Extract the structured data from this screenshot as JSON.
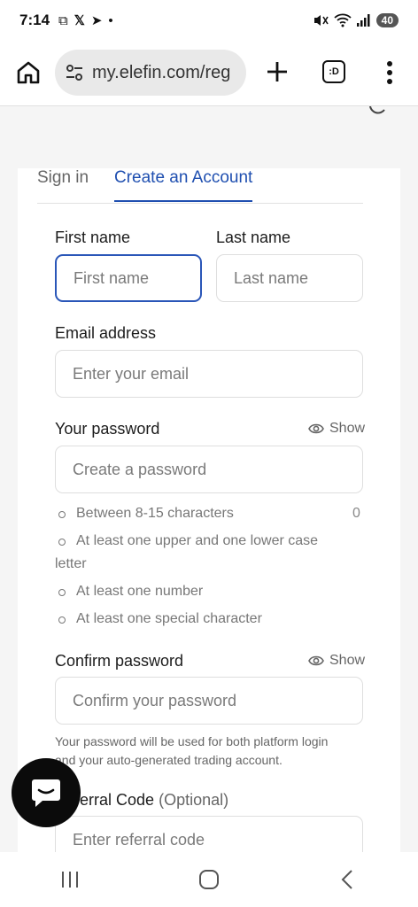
{
  "status_bar": {
    "time": "7:14",
    "battery": "40"
  },
  "browser": {
    "url": "my.elefin.com/reg",
    "tab_count": ":D"
  },
  "tabs": {
    "sign_in": "Sign in",
    "create_account": "Create an Account"
  },
  "form": {
    "first_name_label": "First name",
    "first_name_placeholder": "First name",
    "last_name_label": "Last name",
    "last_name_placeholder": "Last name",
    "email_label": "Email address",
    "email_placeholder": "Enter your email",
    "password_label": "Your password",
    "password_placeholder": "Create a password",
    "show_label": "Show",
    "password_rules": [
      "Between 8-15 characters",
      "At least one upper and one lower case",
      "letter",
      "At least one number",
      "At least one special character"
    ],
    "char_count": "0",
    "confirm_label": "Confirm password",
    "confirm_placeholder": "Confirm your password",
    "confirm_show_label": "Show",
    "hint_line1": "Your password will be used for both platform login",
    "hint_line2": "and your auto-generated trading account.",
    "referral_label": "Referral Code",
    "referral_optional": "(Optional)",
    "referral_placeholder": "Enter referral code"
  },
  "colors": {
    "accent": "#1f4fb0",
    "focus_border": "#2a56b8",
    "chat_button": "#0b0b0b"
  }
}
